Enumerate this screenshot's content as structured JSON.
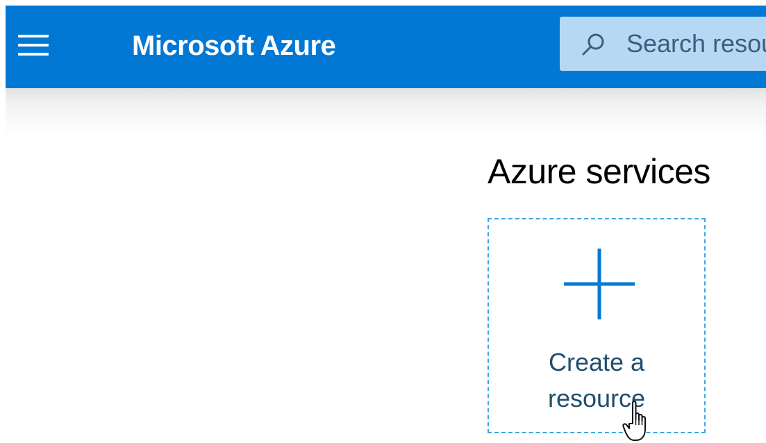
{
  "header": {
    "brand": "Microsoft Azure",
    "menu_icon": "hamburger-menu-icon",
    "search": {
      "icon": "search-icon",
      "placeholder": "Search resources, services, and docs"
    },
    "color": "#0078d4",
    "search_bg": "#b6d8f2"
  },
  "main": {
    "section_title": "Azure services",
    "tiles": [
      {
        "icon": "plus-icon",
        "label_line1": "Create a",
        "label_line2": "resource",
        "icon_color": "#0078d4",
        "border_color": "#3ea7e1"
      }
    ]
  },
  "cursor": {
    "icon": "hand-pointer-cursor-icon"
  }
}
